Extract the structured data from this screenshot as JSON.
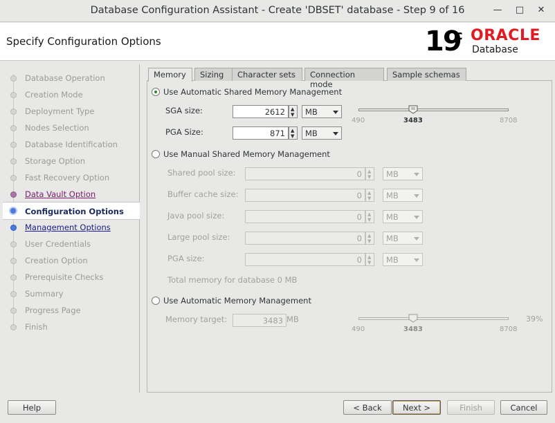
{
  "window": {
    "title": "Database Configuration Assistant - Create 'DBSET' database - Step 9 of 16"
  },
  "header": {
    "page_title": "Specify Configuration Options",
    "brand_version": "19",
    "brand_suffix": "c",
    "brand_name": "ORACLE",
    "brand_product": "Database",
    "brand_color": "#e11b22"
  },
  "steps": [
    {
      "label": "Database Operation",
      "state": "done"
    },
    {
      "label": "Creation Mode",
      "state": "done"
    },
    {
      "label": "Deployment Type",
      "state": "done"
    },
    {
      "label": "Nodes Selection",
      "state": "done"
    },
    {
      "label": "Database Identification",
      "state": "done"
    },
    {
      "label": "Storage Option",
      "state": "done"
    },
    {
      "label": "Fast Recovery Option",
      "state": "done"
    },
    {
      "label": "Data Vault Option",
      "state": "visited"
    },
    {
      "label": "Configuration Options",
      "state": "current"
    },
    {
      "label": "Management Options",
      "state": "link"
    },
    {
      "label": "User Credentials",
      "state": "pending"
    },
    {
      "label": "Creation Option",
      "state": "pending"
    },
    {
      "label": "Prerequisite Checks",
      "state": "pending"
    },
    {
      "label": "Summary",
      "state": "pending"
    },
    {
      "label": "Progress Page",
      "state": "pending"
    },
    {
      "label": "Finish",
      "state": "pending"
    }
  ],
  "tabs": [
    "Memory",
    "Sizing",
    "Character sets",
    "Connection mode",
    "Sample schemas"
  ],
  "asmm": {
    "label": "Use Automatic Shared Memory Management",
    "sga_label": "SGA size:",
    "sga_value": "2612",
    "sga_unit": "MB",
    "pga_label": "PGA Size:",
    "pga_value": "871",
    "pga_unit": "MB",
    "slider_min": "490",
    "slider_value": "3483",
    "slider_max": "8708"
  },
  "manual": {
    "label": "Use Manual Shared Memory Management",
    "rows": [
      {
        "label": "Shared pool size:",
        "value": "0",
        "unit": "MB"
      },
      {
        "label": "Buffer cache size:",
        "value": "0",
        "unit": "MB"
      },
      {
        "label": "Java pool size:",
        "value": "0",
        "unit": "MB"
      },
      {
        "label": "Large pool size:",
        "value": "0",
        "unit": "MB"
      },
      {
        "label": "PGA size:",
        "value": "0",
        "unit": "MB"
      }
    ],
    "total": "Total memory for database 0 MB"
  },
  "amm": {
    "label": "Use Automatic Memory Management",
    "target_label": "Memory target:",
    "target_value": "3483",
    "target_unit": "MB",
    "slider_min": "490",
    "slider_value": "3483",
    "slider_max": "8708",
    "percent": "39%"
  },
  "buttons": {
    "help": "Help",
    "back": "< Back",
    "next": "Next >",
    "finish": "Finish",
    "cancel": "Cancel"
  }
}
